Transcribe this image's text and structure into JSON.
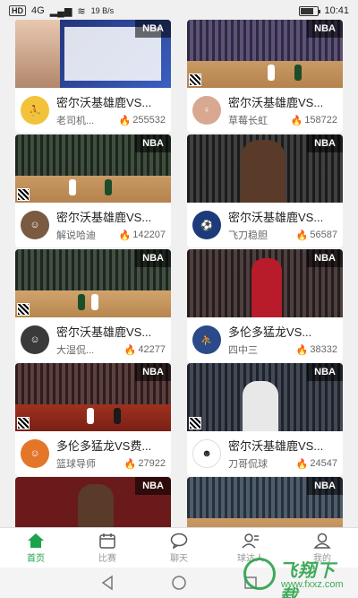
{
  "status_bar": {
    "left_badge": "HD",
    "network": "4G",
    "speed": "19 B/s",
    "time": "10:41"
  },
  "cards": [
    {
      "title": "密尔沃基雄鹿VS...",
      "author": "老司机...",
      "heat": "255532",
      "badge": "NBA"
    },
    {
      "title": "密尔沃基雄鹿VS...",
      "author": "草莓长虹",
      "heat": "158722",
      "badge": "NBA"
    },
    {
      "title": "密尔沃基雄鹿VS...",
      "author": "解说哈迪",
      "heat": "142207",
      "badge": "NBA"
    },
    {
      "title": "密尔沃基雄鹿VS...",
      "author": "飞刀稳胆",
      "heat": "56587",
      "badge": "NBA"
    },
    {
      "title": "密尔沃基雄鹿VS...",
      "author": "大湿侃...",
      "heat": "42277",
      "badge": "NBA"
    },
    {
      "title": "多伦多猛龙VS...",
      "author": "四中三",
      "heat": "38332",
      "badge": "NBA"
    },
    {
      "title": "多伦多猛龙VS费...",
      "author": "篮球导师",
      "heat": "27922",
      "badge": "NBA"
    },
    {
      "title": "密尔沃基雄鹿VS...",
      "author": "刀哥侃球",
      "heat": "24547",
      "badge": "NBA"
    },
    {
      "title": "",
      "author": "",
      "heat": "",
      "badge": "NBA"
    },
    {
      "title": "",
      "author": "",
      "heat": "",
      "badge": "NBA"
    }
  ],
  "tabs": [
    {
      "label": "首页",
      "icon": "home-icon",
      "active": true
    },
    {
      "label": "比赛",
      "icon": "calendar-icon",
      "active": false
    },
    {
      "label": "聊天",
      "icon": "chat-icon",
      "active": false
    },
    {
      "label": "球达人",
      "icon": "experts-icon",
      "active": false
    },
    {
      "label": "我的",
      "icon": "profile-icon",
      "active": false
    }
  ],
  "watermark": {
    "main": "飞翔下载",
    "sub": "www.fxxz.com"
  },
  "colors": {
    "accent": "#1aa34a",
    "flame": "#e8452a"
  }
}
